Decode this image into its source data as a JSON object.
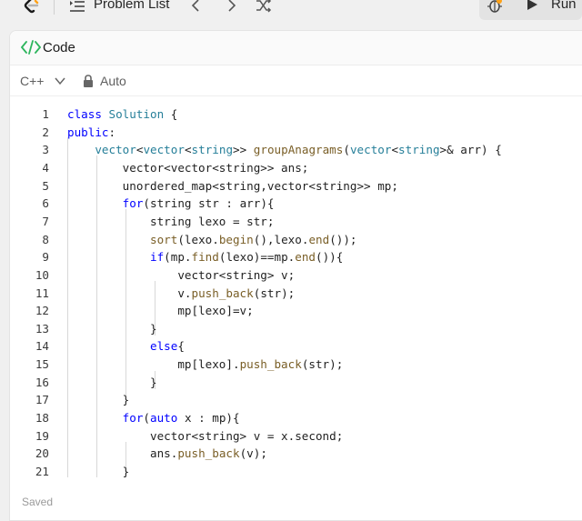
{
  "topbar": {
    "problem_list_label": "Problem List",
    "run_label": "Run",
    "icons": [
      "leetcode-logo-icon",
      "list-icon",
      "chevron-left-icon",
      "chevron-right-icon",
      "shuffle-icon",
      "debug-icon",
      "play-icon"
    ]
  },
  "panel": {
    "title": "Code",
    "language": "C++",
    "mode": "Auto"
  },
  "editor": {
    "lines": [
      {
        "n": "1",
        "t": [
          [
            "kw",
            "class"
          ],
          [
            "pl",
            " "
          ],
          [
            "ty",
            "Solution"
          ],
          [
            "pl",
            " {"
          ]
        ]
      },
      {
        "n": "2",
        "t": [
          [
            "kw",
            "public"
          ],
          [
            "pl",
            ":"
          ]
        ]
      },
      {
        "n": "3",
        "t": [
          [
            "pl",
            "    "
          ],
          [
            "ty",
            "vector"
          ],
          [
            "pl",
            "<"
          ],
          [
            "ty",
            "vector"
          ],
          [
            "pl",
            "<"
          ],
          [
            "ty",
            "string"
          ],
          [
            "pl",
            ">> "
          ],
          [
            "fn",
            "groupAnagrams"
          ],
          [
            "pl",
            "("
          ],
          [
            "ty",
            "vector"
          ],
          [
            "pl",
            "<"
          ],
          [
            "ty",
            "string"
          ],
          [
            "pl",
            ">& arr) {"
          ]
        ]
      },
      {
        "n": "4",
        "t": [
          [
            "pl",
            "        vector<vector<string>> ans;"
          ]
        ]
      },
      {
        "n": "5",
        "t": [
          [
            "pl",
            "        unordered_map<string,vector<string>> mp;"
          ]
        ]
      },
      {
        "n": "6",
        "t": [
          [
            "pl",
            "        "
          ],
          [
            "kw",
            "for"
          ],
          [
            "pl",
            "(string str : arr){"
          ]
        ]
      },
      {
        "n": "7",
        "t": [
          [
            "pl",
            "            string lexo = str;"
          ]
        ]
      },
      {
        "n": "8",
        "t": [
          [
            "pl",
            "            "
          ],
          [
            "fn",
            "sort"
          ],
          [
            "pl",
            "(lexo."
          ],
          [
            "fn",
            "begin"
          ],
          [
            "pl",
            "(),lexo."
          ],
          [
            "fn",
            "end"
          ],
          [
            "pl",
            "());"
          ]
        ]
      },
      {
        "n": "9",
        "t": [
          [
            "pl",
            "            "
          ],
          [
            "kw",
            "if"
          ],
          [
            "pl",
            "(mp."
          ],
          [
            "fn",
            "find"
          ],
          [
            "pl",
            "(lexo)==mp."
          ],
          [
            "fn",
            "end"
          ],
          [
            "pl",
            "()){"
          ]
        ]
      },
      {
        "n": "10",
        "t": [
          [
            "pl",
            "                vector<string> v;"
          ]
        ]
      },
      {
        "n": "11",
        "t": [
          [
            "pl",
            "                v."
          ],
          [
            "fn",
            "push_back"
          ],
          [
            "pl",
            "(str);"
          ]
        ]
      },
      {
        "n": "12",
        "t": [
          [
            "pl",
            "                mp[lexo]=v;"
          ]
        ]
      },
      {
        "n": "13",
        "t": [
          [
            "pl",
            "            }"
          ]
        ]
      },
      {
        "n": "14",
        "t": [
          [
            "pl",
            "            "
          ],
          [
            "kw",
            "else"
          ],
          [
            "pl",
            "{"
          ]
        ]
      },
      {
        "n": "15",
        "t": [
          [
            "pl",
            "                mp[lexo]."
          ],
          [
            "fn",
            "push_back"
          ],
          [
            "pl",
            "(str);"
          ]
        ]
      },
      {
        "n": "16",
        "t": [
          [
            "pl",
            "            }"
          ]
        ]
      },
      {
        "n": "17",
        "t": [
          [
            "pl",
            "        }"
          ]
        ]
      },
      {
        "n": "18",
        "t": [
          [
            "pl",
            "        "
          ],
          [
            "kw",
            "for"
          ],
          [
            "pl",
            "("
          ],
          [
            "kw",
            "auto"
          ],
          [
            "pl",
            " x : mp){"
          ]
        ]
      },
      {
        "n": "19",
        "t": [
          [
            "pl",
            "            vector<string> v = x.second;"
          ]
        ]
      },
      {
        "n": "20",
        "t": [
          [
            "pl",
            "            ans."
          ],
          [
            "fn",
            "push_back"
          ],
          [
            "pl",
            "(v);"
          ]
        ]
      },
      {
        "n": "21",
        "t": [
          [
            "pl",
            "        }"
          ]
        ]
      }
    ]
  },
  "footer": {
    "status": "Saved"
  },
  "colors": {
    "keyword": "#0000ff",
    "type": "#267f99",
    "function": "#795e26",
    "accent_code_icon": "#2db55d"
  }
}
